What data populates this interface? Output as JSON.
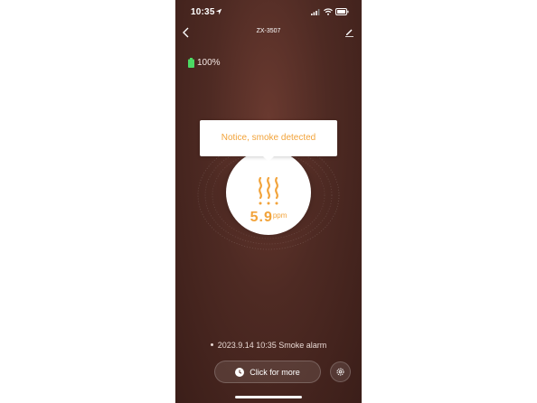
{
  "status_bar": {
    "time": "10:35"
  },
  "nav": {
    "title": "ZX-3507"
  },
  "battery": {
    "percent_text": "100%",
    "color": "#4cd964"
  },
  "notice": {
    "text": "Notice, smoke detected"
  },
  "reading": {
    "value": "5.9",
    "unit": "ppm"
  },
  "log": {
    "entry": "2023.9.14 10:35 Smoke alarm"
  },
  "actions": {
    "more_label": "Click for more"
  },
  "colors": {
    "accent": "#f2a33a",
    "background": "#4e2a23"
  },
  "icons": [
    "back-icon",
    "edit-icon",
    "battery-icon",
    "smoke-icon",
    "clock-icon",
    "gear-icon"
  ]
}
